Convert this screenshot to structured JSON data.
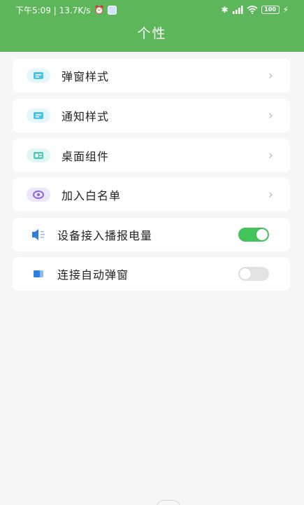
{
  "status_bar": {
    "time_speed": "下午5:09 | 13.7K/s",
    "battery": "100"
  },
  "header": {
    "title": "个性"
  },
  "menu": [
    {
      "label": "弹窗样式",
      "icon": "popup-style-icon",
      "accent": "#4ec3ea",
      "type": "link"
    },
    {
      "label": "通知样式",
      "icon": "notification-style-icon",
      "accent": "#4ec3ea",
      "type": "link"
    },
    {
      "label": "桌面组件",
      "icon": "desktop-widget-icon",
      "accent": "#4fc9b7",
      "type": "link"
    },
    {
      "label": "加入白名单",
      "icon": "whitelist-icon",
      "accent": "#8a6ad8",
      "type": "link"
    },
    {
      "label": "设备接入播报电量",
      "icon": "speaker-icon",
      "accent": "#2e7de0",
      "type": "toggle",
      "enabled": true
    },
    {
      "label": "连接自动弹窗",
      "icon": "auto-popup-icon",
      "accent": "#2e7de0",
      "type": "toggle",
      "enabled": false
    }
  ],
  "colors": {
    "header_bg": "#5db659",
    "toggle_on": "#43c45b",
    "toggle_off": "#e3e3e3",
    "page_bg": "#f6f6f6"
  },
  "chevron_glyph": "›"
}
